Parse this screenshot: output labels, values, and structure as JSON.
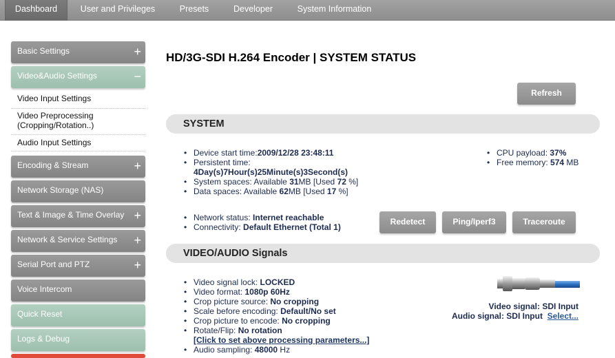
{
  "nav": {
    "tabs": [
      {
        "label": "Dashboard"
      },
      {
        "label": "User and Privileges"
      },
      {
        "label": "Presets"
      },
      {
        "label": "Developer"
      },
      {
        "label": "System Information"
      }
    ]
  },
  "sidebar": {
    "items": [
      {
        "label": "Basic Settings",
        "toggle": "+"
      },
      {
        "label": "Video&Audio Settings",
        "toggle": "−"
      },
      {
        "label": "Encoding & Stream",
        "toggle": "+"
      },
      {
        "label": "Network Storage (NAS)"
      },
      {
        "label": "Text & Image & Time Overlay",
        "toggle": "+"
      },
      {
        "label": "Network & Service Settings",
        "toggle": "+"
      },
      {
        "label": "Serial Port and PTZ",
        "toggle": "+"
      },
      {
        "label": "Voice Intercom"
      },
      {
        "label": "Quick Reset"
      },
      {
        "label": "Logs & Debug"
      }
    ],
    "subitems": [
      {
        "label": "Video Input Settings"
      },
      {
        "label": "Video Preprocessing\n(Cropping/Rotation..)"
      },
      {
        "label": "Audio Input Settings"
      }
    ]
  },
  "main": {
    "title": "HD/3G-SDI H.264 Encoder | SYSTEM STATUS",
    "refresh_label": "Refresh",
    "system": {
      "header": "SYSTEM",
      "start_label": "Device start time:",
      "start_value": "2009/12/28 23:48:11",
      "persist_label": "Persistent time:",
      "persist_value": "4Day(s)7Hour(s)25Minute(s)3Second(s)",
      "sys_label": "System spaces: Available ",
      "sys_avail": "31",
      "sys_mid": "MB [Used ",
      "sys_used": "72",
      "sys_end": " %]",
      "data_label": "Data spaces: Available ",
      "data_avail": "62",
      "data_mid": "MB [Used ",
      "data_used": "17",
      "data_end": " %]",
      "cpu_label": "CPU payload: ",
      "cpu_value": "37%",
      "mem_label": "Free memory: ",
      "mem_value": "574",
      "mem_unit": " MB",
      "net_label": "Network status: ",
      "net_value": "Internet reachable",
      "conn_label": "Connectivity: ",
      "conn_value": "Default Ethernet (Total 1)",
      "redetect_label": "Redetect",
      "ping_label": "Ping/Iperf3",
      "traceroute_label": "Traceroute"
    },
    "signals": {
      "header": "VIDEO/AUDIO Signals",
      "lock_label": "Video signal lock: ",
      "lock_value": "LOCKED",
      "format_label": "Video format: ",
      "format_value": "1080p 60Hz",
      "crop_src_label": "Crop picture source: ",
      "crop_src_value": "No cropping",
      "scale_label": "Scale before encoding: ",
      "scale_value": "Default/No set",
      "crop_enc_label": "Crop picture to encode: ",
      "crop_enc_value": "No cropping",
      "rotate_label": "Rotate/Flip: ",
      "rotate_value": "No rotation",
      "params_link": "[Click to set above processing parameters...]",
      "audio_label": "Audio sampling: ",
      "audio_value": "48000",
      "audio_unit": " Hz",
      "video_signal": "Video signal: SDI Input",
      "audio_signal": "Audio signal: SDI Input",
      "select_link": "Select..."
    }
  },
  "colors": {
    "nav": "#999999",
    "sidebar_gray": "#8f8f8f",
    "sidebar_green": "#a8c8b7",
    "accent_red": "#e04a3a"
  }
}
